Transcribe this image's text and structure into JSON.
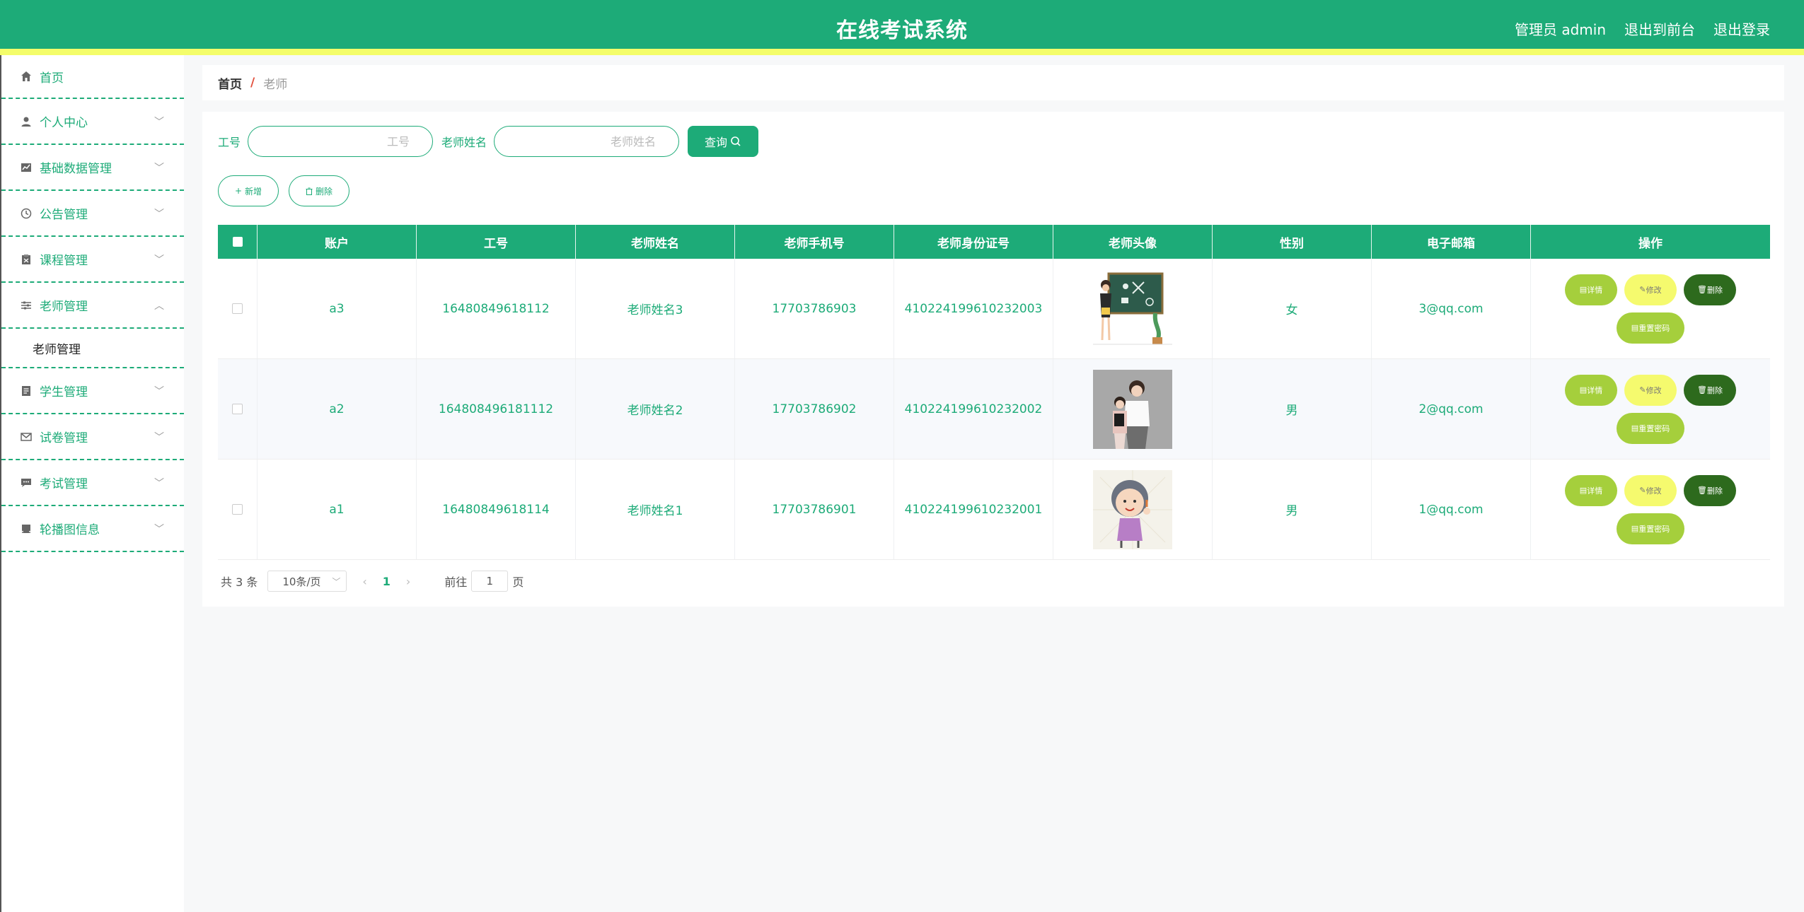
{
  "header": {
    "title": "在线考试系统",
    "admin": "管理员 admin",
    "to_front": "退出到前台",
    "logout": "退出登录"
  },
  "sidebar": {
    "items": [
      {
        "label": "首页",
        "icon": "home-icon"
      },
      {
        "label": "个人中心",
        "icon": "user-icon"
      },
      {
        "label": "基础数据管理",
        "icon": "chart-icon"
      },
      {
        "label": "公告管理",
        "icon": "clock-icon"
      },
      {
        "label": "课程管理",
        "icon": "clipboard-icon"
      },
      {
        "label": "老师管理",
        "icon": "sliders-icon"
      },
      {
        "label": "学生管理",
        "icon": "document-icon"
      },
      {
        "label": "试卷管理",
        "icon": "mail-icon"
      },
      {
        "label": "考试管理",
        "icon": "message-icon"
      },
      {
        "label": "轮播图信息",
        "icon": "printer-icon"
      }
    ],
    "submenu": "老师管理"
  },
  "breadcrumb": {
    "home": "首页",
    "sep": "/",
    "current": "老师"
  },
  "search": {
    "job_label": "工号",
    "job_placeholder": "工号",
    "name_label": "老师姓名",
    "name_placeholder": "老师姓名",
    "query": "查询"
  },
  "actions": {
    "add": "新增",
    "delete": "删除"
  },
  "table": {
    "headers": [
      "账户",
      "工号",
      "老师姓名",
      "老师手机号",
      "老师身份证号",
      "老师头像",
      "性别",
      "电子邮箱",
      "操作"
    ],
    "rows": [
      {
        "account": "a3",
        "job_no": "16480849618112",
        "name": "老师姓名3",
        "phone": "17703786903",
        "id_card": "410224199610232003",
        "gender": "女",
        "email": "3@qq.com"
      },
      {
        "account": "a2",
        "job_no": "164808496181112",
        "name": "老师姓名2",
        "phone": "17703786902",
        "id_card": "410224199610232002",
        "gender": "男",
        "email": "2@qq.com"
      },
      {
        "account": "a1",
        "job_no": "16480849618114",
        "name": "老师姓名1",
        "phone": "17703786901",
        "id_card": "410224199610232001",
        "gender": "男",
        "email": "1@qq.com"
      }
    ],
    "ops": {
      "detail": "详情",
      "edit": "修改",
      "remove": "删除",
      "reset": "重置密码"
    }
  },
  "pager": {
    "total": "共 3 条",
    "size": "10条/页",
    "page": "1",
    "goto": "前往",
    "goto_value": "1",
    "unit": "页"
  },
  "colors": {
    "primary": "#1dab78",
    "accent_yellow": "#f4fd6a",
    "op_green": "#a5cf3c",
    "op_dark": "#2d6a1d"
  }
}
